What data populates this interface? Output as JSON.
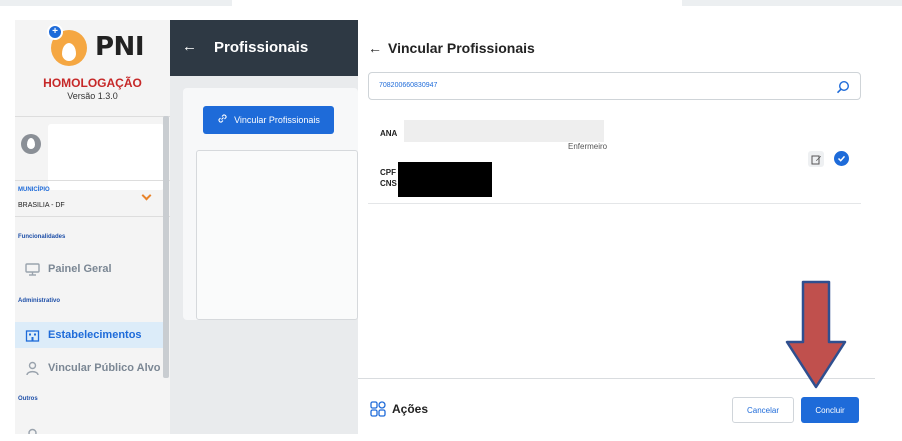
{
  "app": {
    "logo_text": "PNI",
    "environment": "HOMOLOGAÇÃO",
    "version": "Versão 1.3.0"
  },
  "sidebar": {
    "municipio_label": "MUNICÍPIO",
    "municipio_value": "BRASILIA - DF",
    "sections": [
      {
        "label": "Funcionalidades"
      },
      {
        "label": "Administrativo"
      },
      {
        "label": "Outros"
      }
    ],
    "items": [
      {
        "label": "Painel Geral",
        "icon": "monitor-icon",
        "active": false
      },
      {
        "label": "Estabelecimentos",
        "icon": "building-icon",
        "active": true
      },
      {
        "label": "Vincular Público Alvo",
        "icon": "person-icon",
        "active": false
      },
      {
        "label": "",
        "icon": "pin-icon",
        "active": false
      }
    ]
  },
  "page": {
    "title": "Profissionais",
    "vincular_button": "Vincular Profissionais"
  },
  "panel": {
    "title": "Vincular Profissionais",
    "search_value": "708200660830947",
    "result": {
      "name": "ANA",
      "role": "Enfermeiro",
      "cpf_label": "CPF",
      "cns_label": "CNS"
    },
    "footer": {
      "actions_label": "Ações",
      "cancel_label": "Cancelar",
      "confirm_label": "Concluir"
    }
  },
  "colors": {
    "primary": "#1e6bd9",
    "header_dark": "#2e3944",
    "environment": "#c62828",
    "annotation_arrow": "#c0504d"
  }
}
